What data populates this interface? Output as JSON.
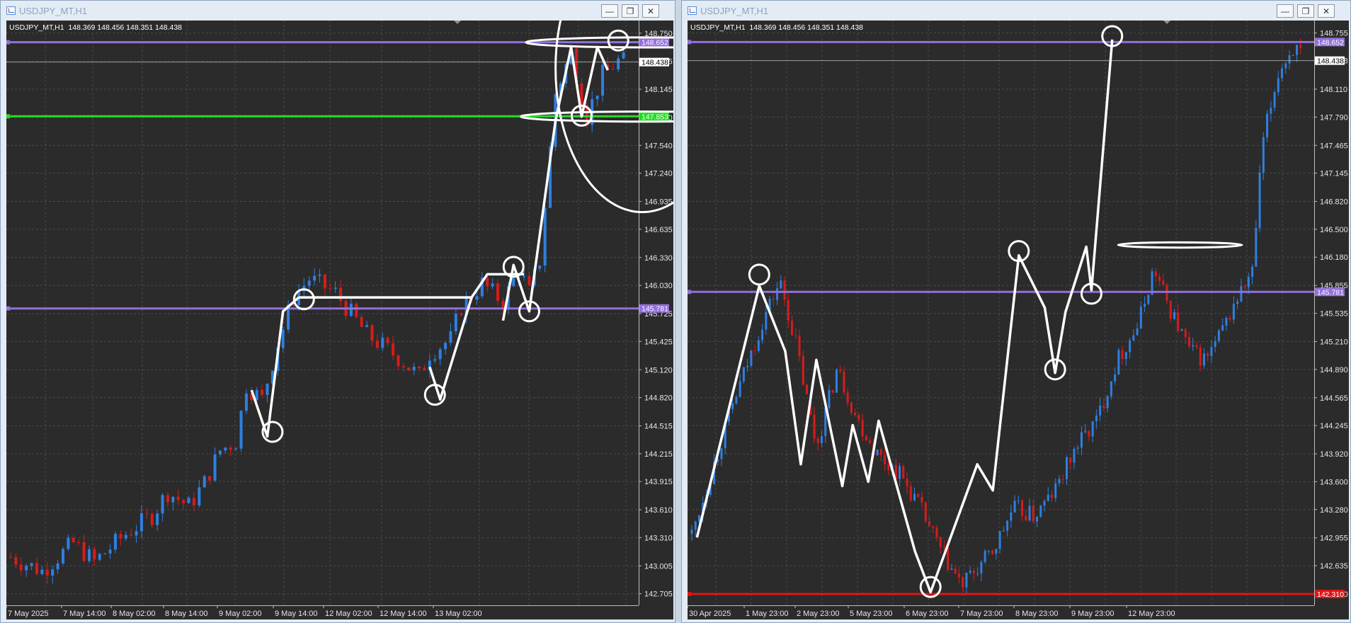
{
  "colors": {
    "background": "#2b2b2b",
    "grid": "#4a4a4a",
    "bull": "#2f7fe0",
    "bear": "#d61c1c",
    "purple_line": "#9370db",
    "green_line": "#22dd22",
    "red_line": "#e01515",
    "drawing": "#ffffff",
    "axis_text": "#e6e6e6"
  },
  "left": {
    "window_title": "USDJPY_MT,H1",
    "window_buttons": {
      "minimize_icon": "minimize-icon",
      "restore_icon": "restore-icon",
      "close_icon": "close-icon"
    },
    "header": "USDJPY_MT,H1  148.369 148.456 148.351 148.438",
    "chart_data": {
      "type": "candlestick",
      "symbol": "USDJPY_MT",
      "timeframe": "H1",
      "ohlc": {
        "open": 148.369,
        "high": 148.456,
        "low": 148.351,
        "close": 148.438
      },
      "price_ticks": [
        "148.750",
        "148.445",
        "148.145",
        "147.840",
        "147.540",
        "147.240",
        "146.935",
        "146.635",
        "146.330",
        "146.030",
        "145.725",
        "145.425",
        "145.120",
        "144.820",
        "144.515",
        "144.215",
        "143.915",
        "143.610",
        "143.310",
        "143.005",
        "142.705"
      ],
      "time_labels": [
        "7 May 2025",
        "7 May 14:00",
        "8 May 02:00",
        "8 May 14:00",
        "9 May 02:00",
        "9 May 14:00",
        "12 May 02:00",
        "12 May 14:00",
        "13 May 02:00"
      ],
      "ylim": [
        142.58,
        148.84
      ],
      "bars": 118,
      "path": [
        [
          0,
          143.1
        ],
        [
          6,
          142.95
        ],
        [
          12,
          143.25
        ],
        [
          16,
          143.05
        ],
        [
          22,
          143.35
        ],
        [
          27,
          143.55
        ],
        [
          30,
          143.8
        ],
        [
          34,
          143.65
        ],
        [
          37,
          143.9
        ],
        [
          40,
          144.25
        ],
        [
          43,
          144.35
        ],
        [
          45,
          144.95
        ],
        [
          48,
          144.8
        ],
        [
          51,
          145.4
        ],
        [
          54,
          145.9
        ],
        [
          57,
          146.1
        ],
        [
          62,
          145.95
        ],
        [
          68,
          145.5
        ],
        [
          74,
          145.25
        ],
        [
          78,
          145.05
        ],
        [
          80,
          145.3
        ],
        [
          84,
          145.45
        ],
        [
          86,
          145.8
        ],
        [
          90,
          146.05
        ],
        [
          94,
          145.85
        ],
        [
          97,
          146.2
        ],
        [
          99,
          145.95
        ],
        [
          101,
          146.3
        ],
        [
          104,
          148.1
        ],
        [
          107,
          148.55
        ],
        [
          110,
          147.85
        ],
        [
          113,
          148.3
        ],
        [
          116,
          148.45
        ],
        [
          118,
          148.44
        ]
      ],
      "horizontal_levels": [
        {
          "price": 148.652,
          "label": "148.652",
          "color": "#9370db",
          "label_text_color": "#ffffff"
        },
        {
          "price": 147.853,
          "label": "147.853",
          "color": "#22dd22",
          "label_text_color": "#ffffff"
        },
        {
          "price": 145.781,
          "label": "145.781",
          "color": "#9370db",
          "label_text_color": "#ffffff"
        }
      ],
      "current_price": {
        "price": 148.438,
        "label": "148.438"
      },
      "annotations": {
        "polylines": [
          [
            [
              46,
              144.9
            ],
            [
              49,
              144.4
            ],
            [
              52,
              145.75
            ],
            [
              55,
              145.9
            ]
          ],
          [
            [
              55,
              145.9
            ],
            [
              88,
              145.9
            ],
            [
              91,
              146.15
            ],
            [
              98,
              146.15
            ]
          ],
          [
            [
              80,
              145.15
            ],
            [
              82,
              144.8
            ],
            [
              88,
              145.9
            ]
          ],
          [
            [
              94,
              145.65
            ],
            [
              96,
              146.25
            ],
            [
              99,
              145.75
            ],
            [
              104,
              147.8
            ],
            [
              107,
              148.6
            ],
            [
              109,
              147.85
            ],
            [
              112,
              148.6
            ],
            [
              114,
              148.35
            ]
          ]
        ],
        "circles": [
          [
            50,
            144.45
          ],
          [
            56,
            145.88
          ],
          [
            81,
            144.85
          ],
          [
            96,
            146.23
          ],
          [
            99,
            145.75
          ],
          [
            109,
            147.86
          ],
          [
            116,
            148.67
          ]
        ],
        "ellipses": [
          [
            108,
            148.37,
            49,
            3.1,
            0.5
          ],
          [
            104,
            148.65,
            69,
            1.2,
            0.045
          ],
          [
            103,
            147.85,
            69,
            1.2,
            0.045
          ]
        ]
      }
    }
  },
  "right": {
    "window_title": "USDJPY_MT,H1",
    "window_buttons": {
      "minimize_icon": "minimize-icon",
      "restore_icon": "restore-icon",
      "close_icon": "close-icon"
    },
    "header": "USDJPY_MT,H1  148.369 148.456 148.351 148.438",
    "chart_data": {
      "type": "candlestick",
      "symbol": "USDJPY_MT",
      "timeframe": "H1",
      "ohlc": {
        "open": 148.369,
        "high": 148.456,
        "low": 148.351,
        "close": 148.438
      },
      "price_ticks": [
        "148.755",
        "148.438",
        "148.110",
        "147.790",
        "147.465",
        "147.145",
        "146.820",
        "146.500",
        "146.180",
        "145.855",
        "145.535",
        "145.210",
        "144.890",
        "144.565",
        "144.245",
        "143.920",
        "143.600",
        "143.280",
        "142.955",
        "142.635",
        "142.310"
      ],
      "time_labels": [
        "30 Apr 2025",
        "1 May 23:00",
        "2 May 23:00",
        "5 May 23:00",
        "6 May 23:00",
        "7 May 23:00",
        "8 May 23:00",
        "9 May 23:00",
        "12 May 23:00"
      ],
      "ylim": [
        142.18,
        148.85
      ],
      "bars": 165,
      "path": [
        [
          0,
          143.0
        ],
        [
          8,
          144.5
        ],
        [
          14,
          145.5
        ],
        [
          17,
          145.9
        ],
        [
          20,
          145.2
        ],
        [
          24,
          144.0
        ],
        [
          28,
          144.9
        ],
        [
          32,
          144.3
        ],
        [
          36,
          143.9
        ],
        [
          40,
          143.7
        ],
        [
          44,
          143.3
        ],
        [
          48,
          142.8
        ],
        [
          52,
          142.4
        ],
        [
          55,
          142.6
        ],
        [
          58,
          142.8
        ],
        [
          62,
          143.3
        ],
        [
          66,
          143.2
        ],
        [
          70,
          143.5
        ],
        [
          74,
          144.0
        ],
        [
          78,
          144.3
        ],
        [
          82,
          145.0
        ],
        [
          86,
          145.4
        ],
        [
          89,
          146.05
        ],
        [
          92,
          145.6
        ],
        [
          96,
          145.1
        ],
        [
          99,
          145.0
        ],
        [
          102,
          145.3
        ],
        [
          105,
          145.7
        ],
        [
          108,
          146.0
        ],
        [
          110,
          147.5
        ],
        [
          113,
          148.3
        ],
        [
          116,
          148.6
        ],
        [
          118,
          148.44
        ]
      ],
      "horizontal_levels": [
        {
          "price": 148.652,
          "label": "148.652",
          "color": "#9370db",
          "label_text_color": "#ffffff"
        },
        {
          "price": 145.781,
          "label": "145.781",
          "color": "#9370db",
          "label_text_color": "#ffffff"
        },
        {
          "price": 142.31,
          "label": "142.310",
          "color": "#e01515",
          "label_text_color": "#ffffff"
        }
      ],
      "current_price": {
        "price": 148.438,
        "label": "148.438"
      },
      "annotations": {
        "polylines": [
          [
            [
              1,
              142.96
            ],
            [
              13,
              145.85
            ],
            [
              18,
              145.1
            ],
            [
              21,
              143.8
            ],
            [
              24,
              145.0
            ],
            [
              29,
              143.55
            ],
            [
              31,
              144.25
            ],
            [
              34,
              143.6
            ],
            [
              36,
              144.3
            ],
            [
              43,
              142.8
            ],
            [
              46,
              142.33
            ],
            [
              55,
              143.8
            ],
            [
              58,
              143.5
            ],
            [
              63,
              146.2
            ],
            [
              68,
              145.6
            ],
            [
              70,
              144.85
            ],
            [
              72,
              145.55
            ],
            [
              76,
              146.3
            ],
            [
              77,
              145.8
            ],
            [
              81,
              148.68
            ]
          ]
        ],
        "circles": [
          [
            13,
            145.98
          ],
          [
            63,
            146.25
          ],
          [
            70,
            144.89
          ],
          [
            77,
            145.76
          ],
          [
            81,
            148.72
          ],
          [
            46,
            142.39
          ]
        ],
        "ellipses": [
          [
            85,
            146.32,
            35,
            1.0,
            0.03
          ]
        ]
      }
    }
  }
}
